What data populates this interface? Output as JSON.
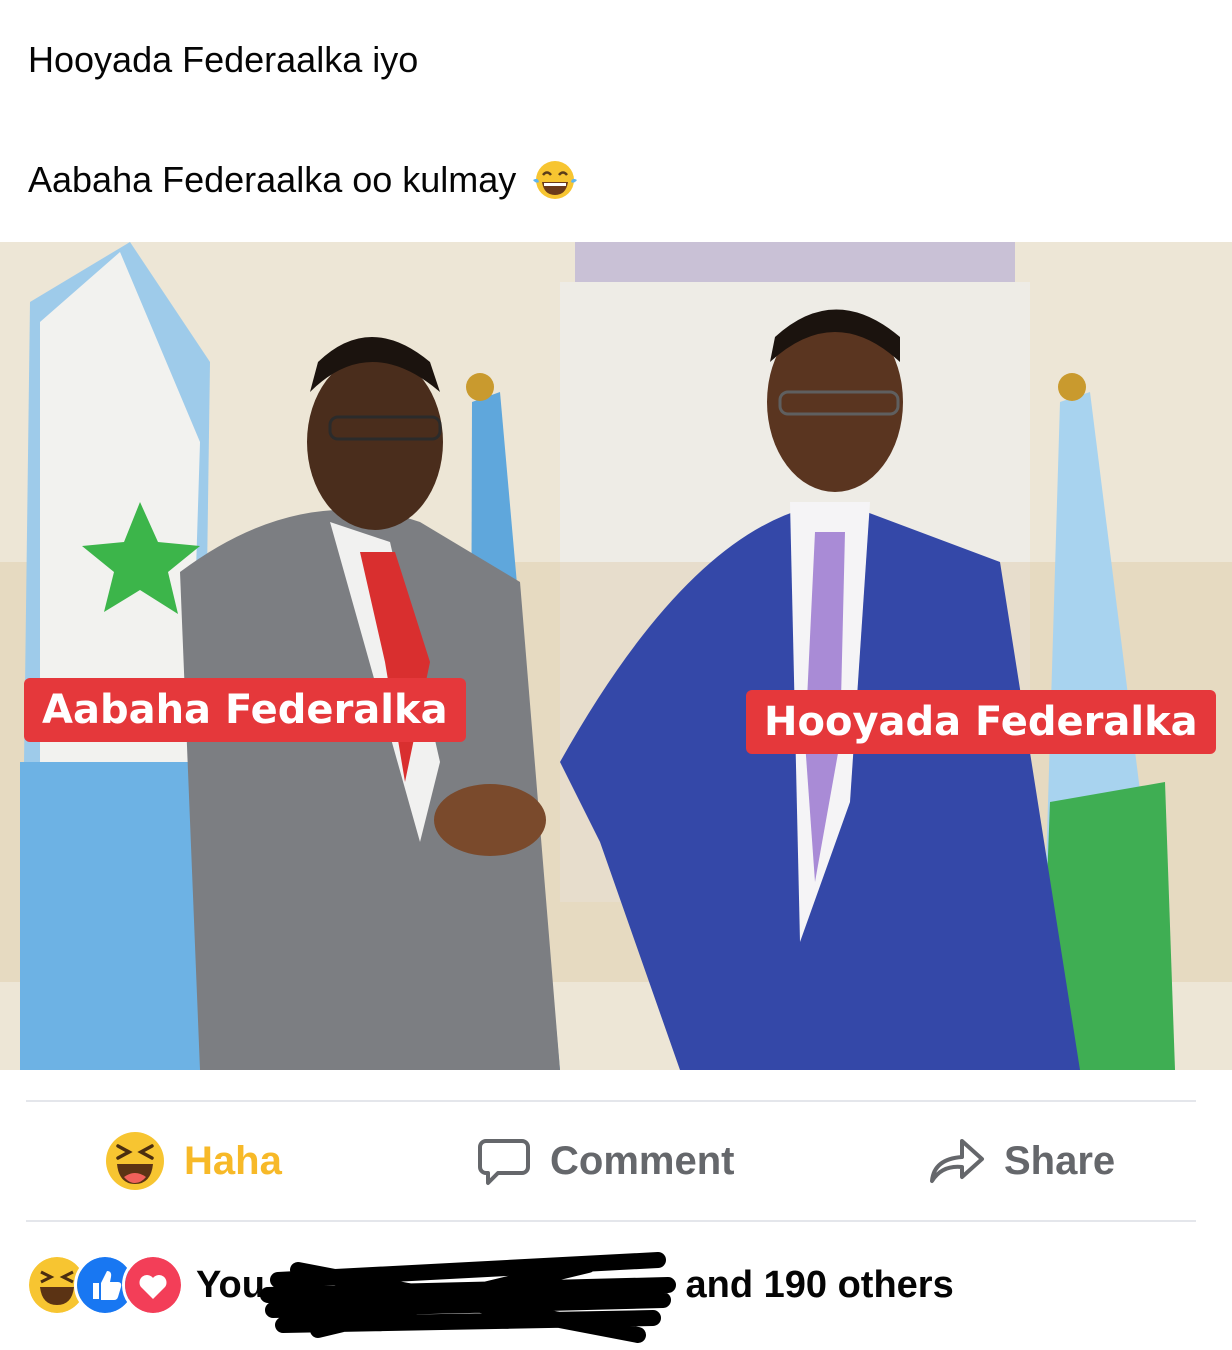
{
  "post": {
    "text_line1": "Hooyada Federaalka iyo",
    "text_line2": "Aabaha Federaalka oo kulmay",
    "text_emoji": "joy-emoji-icon"
  },
  "photo": {
    "label_left": "Aabaha Federalka",
    "label_right": "Hooyada Federalka",
    "label_color": "#e5383b"
  },
  "actions": {
    "reaction_label": "Haha",
    "reaction_color": "#f7b928",
    "comment_label": "Comment",
    "share_label": "Share"
  },
  "reactions_summary": {
    "icons": [
      "haha-icon",
      "like-icon",
      "love-icon"
    ],
    "you_label": "You,",
    "others_label": "and 190 others"
  }
}
